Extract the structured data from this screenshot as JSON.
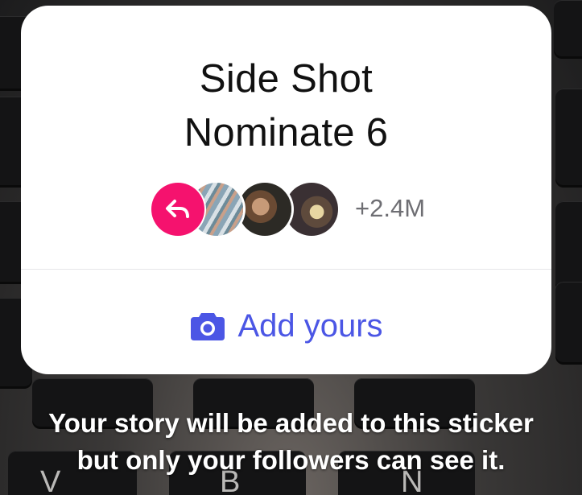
{
  "sticker": {
    "title_line1": "Side Shot",
    "title_line2": "Nominate 6",
    "participants_count": "+2.4M",
    "add_label": "Add yours"
  },
  "caption": {
    "line1": "Your story will be added to this sticker",
    "line2": "but only your followers can see it."
  },
  "background_keys": [
    "V",
    "B",
    "N"
  ],
  "icons": {
    "reply": "reply-arrow-icon",
    "camera": "camera-icon"
  },
  "colors": {
    "accent_blue": "#4b56e5",
    "reply_pink": "#f5126e",
    "count_gray": "#6e6e73"
  }
}
